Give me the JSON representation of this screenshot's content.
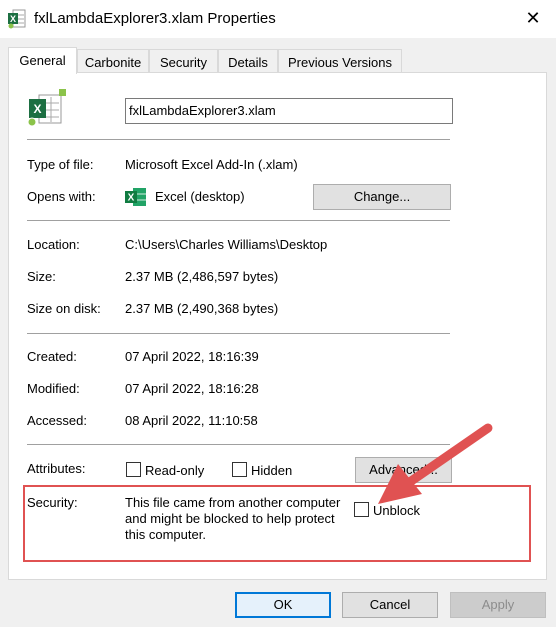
{
  "window": {
    "title": "fxlLambdaExplorer3.xlam Properties",
    "close_glyph": "✕",
    "file_icon": "excel-addin-icon"
  },
  "tabs": [
    {
      "label": "General",
      "active": true
    },
    {
      "label": "Carbonite",
      "active": false
    },
    {
      "label": "Security",
      "active": false
    },
    {
      "label": "Details",
      "active": false
    },
    {
      "label": "Previous Versions",
      "active": false
    }
  ],
  "general": {
    "filename": "fxlLambdaExplorer3.xlam",
    "type_label": "Type of file:",
    "type_value": "Microsoft Excel Add-In (.xlam)",
    "opens_label": "Opens with:",
    "opens_value": "Excel (desktop)",
    "change_label": "Change...",
    "location_label": "Location:",
    "location_value": "C:\\Users\\Charles Williams\\Desktop",
    "size_label": "Size:",
    "size_value": "2.37 MB (2,486,597 bytes)",
    "size_disk_label": "Size on disk:",
    "size_disk_value": "2.37 MB (2,490,368 bytes)",
    "created_label": "Created:",
    "created_value": "07 April 2022, 18:16:39",
    "modified_label": "Modified:",
    "modified_value": "07 April 2022, 18:16:28",
    "accessed_label": "Accessed:",
    "accessed_value": "08 April 2022, 11:10:58",
    "attributes_label": "Attributes:",
    "readonly_label": "Read-only",
    "readonly_checked": false,
    "hidden_label": "Hidden",
    "hidden_checked": false,
    "advanced_label": "Advanced...",
    "security_label": "Security:",
    "security_line1": "This file came from another computer",
    "security_line2": "and might be blocked to help protect",
    "security_line3": "this computer.",
    "unblock_label": "Unblock",
    "unblock_checked": false
  },
  "footer": {
    "ok_label": "OK",
    "cancel_label": "Cancel",
    "apply_label": "Apply"
  },
  "annotation": {
    "highlight_color": "#e05252"
  }
}
